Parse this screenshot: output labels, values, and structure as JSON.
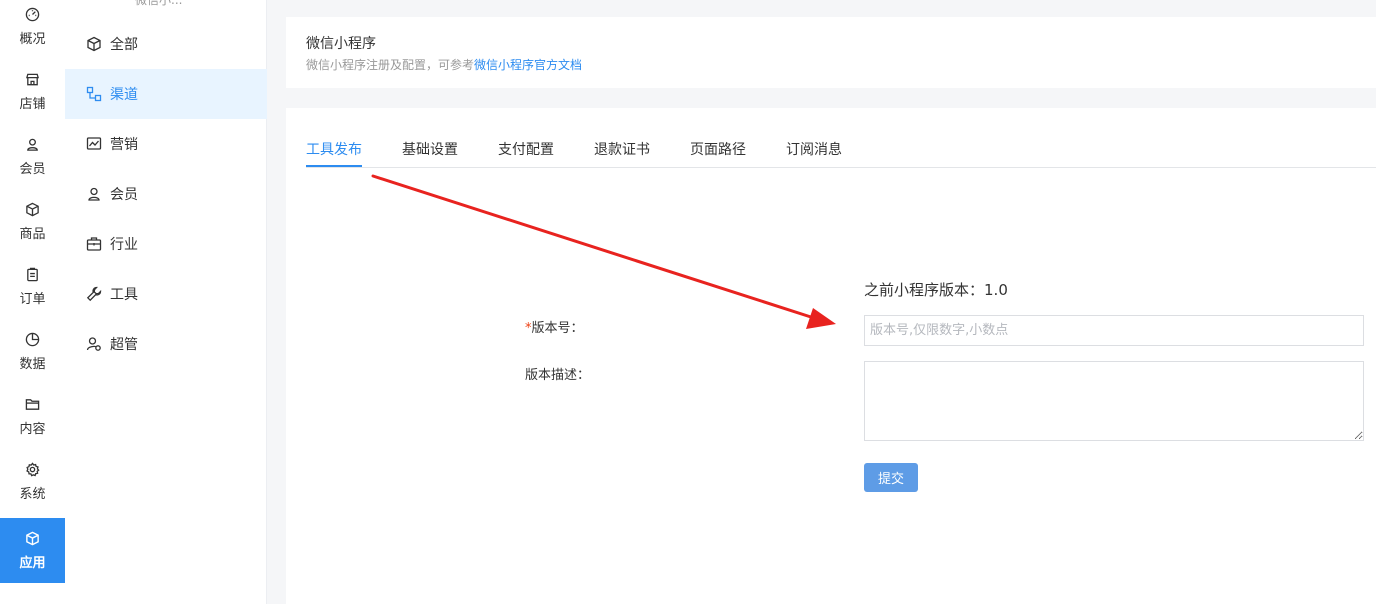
{
  "rail": {
    "items": [
      {
        "label": "概况",
        "icon": "dashboard-icon"
      },
      {
        "label": "店铺",
        "icon": "store-icon"
      },
      {
        "label": "会员",
        "icon": "user-icon"
      },
      {
        "label": "商品",
        "icon": "box-icon"
      },
      {
        "label": "订单",
        "icon": "clipboard-icon"
      },
      {
        "label": "数据",
        "icon": "pie-chart-icon"
      },
      {
        "label": "内容",
        "icon": "folder-icon"
      },
      {
        "label": "系统",
        "icon": "gear-icon"
      },
      {
        "label": "应用",
        "icon": "box-icon"
      }
    ],
    "active_index": 8
  },
  "subnav": {
    "top_partial": "微信小...",
    "items": [
      {
        "label": "全部",
        "icon": "cube-icon"
      },
      {
        "label": "渠道",
        "icon": "channel-icon"
      },
      {
        "label": "营销",
        "icon": "trend-icon"
      },
      {
        "label": "会员",
        "icon": "user-icon"
      },
      {
        "label": "行业",
        "icon": "briefcase-icon"
      },
      {
        "label": "工具",
        "icon": "wrench-icon"
      },
      {
        "label": "超管",
        "icon": "admin-icon"
      }
    ],
    "active_index": 1
  },
  "header": {
    "title": "微信小程序",
    "subtitle_prefix": "微信小程序注册及配置，可参考",
    "subtitle_link": "微信小程序官方文档"
  },
  "tabs": {
    "items": [
      "工具发布",
      "基础设置",
      "支付配置",
      "退款证书",
      "页面路径",
      "订阅消息"
    ],
    "active_index": 0
  },
  "form": {
    "prev_version_label": "之前小程序版本：",
    "prev_version_value": "1.0",
    "version_required_mark": "*",
    "version_label": "版本号：",
    "version_placeholder": "版本号,仅限数字,小数点",
    "version_value": "",
    "desc_label": "版本描述：",
    "desc_value": "",
    "submit_label": "提交"
  },
  "colors": {
    "accent": "#2d8cf0",
    "annotation_arrow": "#e8231f",
    "submit_bg": "#5e9ce6"
  }
}
